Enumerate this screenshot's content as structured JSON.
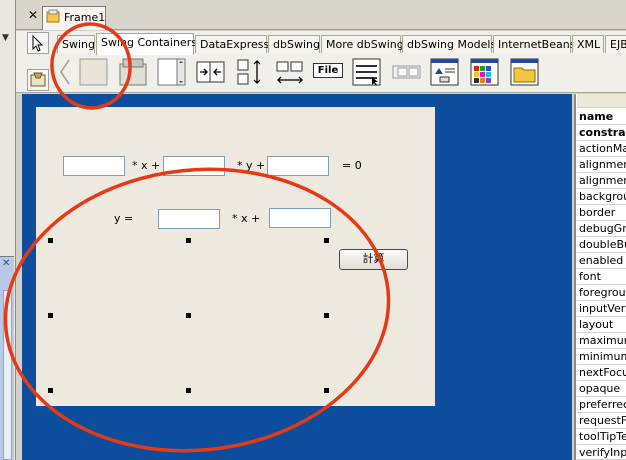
{
  "document_tab": {
    "label": "Frame1"
  },
  "palette_tabs": [
    {
      "label": "Swing",
      "active": false
    },
    {
      "label": "Swing Containers",
      "active": true
    },
    {
      "label": "DataExpress",
      "active": false
    },
    {
      "label": "dbSwing",
      "active": false
    },
    {
      "label": "More dbSwing",
      "active": false
    },
    {
      "label": "dbSwing Models",
      "active": false
    },
    {
      "label": "InternetBeans",
      "active": false
    },
    {
      "label": "XML",
      "active": false
    },
    {
      "label": "EJB",
      "active": false
    }
  ],
  "palette_tools": {
    "file_chooser_label": "File"
  },
  "form": {
    "row1": {
      "x_label": "* x +",
      "y_label": "* y +",
      "eq_label": "= 0"
    },
    "row2": {
      "y_label": "y =",
      "x_label": "* x +"
    },
    "button_label": "計算"
  },
  "properties": {
    "header": "name",
    "items": [
      "constrain",
      "actionMap",
      "alignmentX",
      "alignmentY",
      "background",
      "border",
      "debugGraphics",
      "doubleBuffered",
      "enabled",
      "font",
      "foreground",
      "inputVerifier",
      "layout",
      "maximumSize",
      "minimumSize",
      "nextFocus",
      "opaque",
      "preferredSize",
      "requestFocus",
      "toolTipText",
      "verifyInput"
    ]
  },
  "colors": {
    "design_bg": "#0d4d9e",
    "frame_bg": "#ede9df",
    "annotation": "#e63a17"
  }
}
